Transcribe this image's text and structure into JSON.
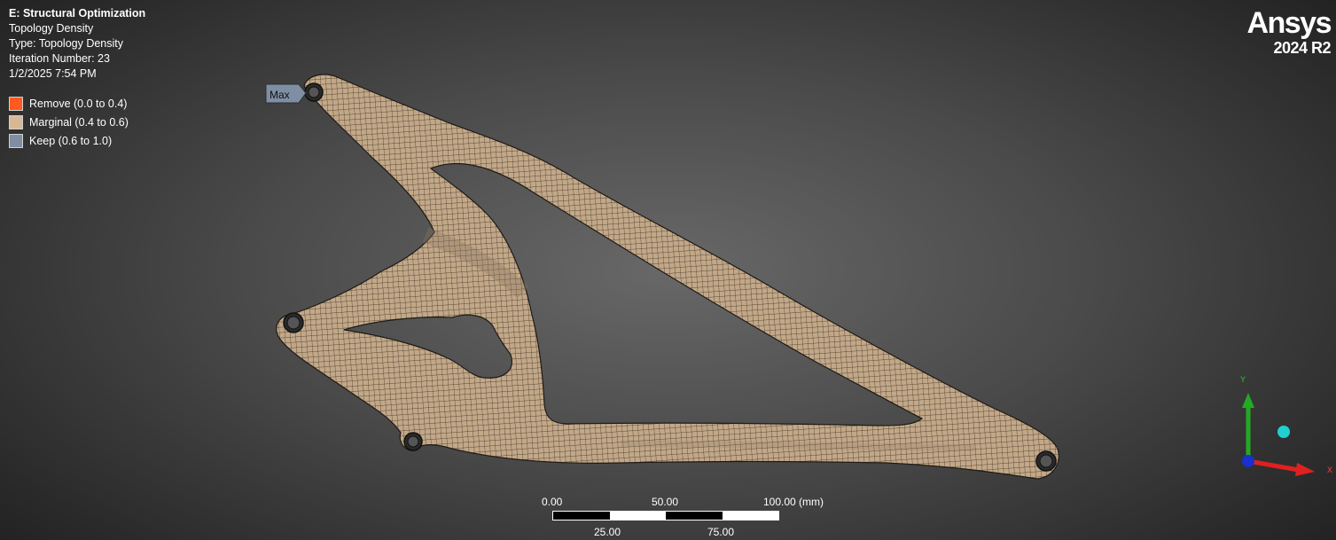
{
  "header": {
    "title": "E: Structural Optimization",
    "lines": [
      "Topology Density",
      "Type: Topology Density",
      "Iteration Number: 23",
      "1/2/2025 7:54 PM"
    ]
  },
  "legend": [
    {
      "label": "Remove (0.0 to 0.4)",
      "color": "#ff5a1f"
    },
    {
      "label": "Marginal (0.4 to 0.6)",
      "color": "#d8b797"
    },
    {
      "label": "Keep (0.6 to 1.0)",
      "color": "#7f8ea3"
    }
  ],
  "brand": {
    "name": "Ansys",
    "version": "2024 R2"
  },
  "probe": {
    "label": "Max"
  },
  "scale_bar": {
    "top_labels": [
      "0.00",
      "50.00",
      "100.00 (mm)"
    ],
    "bottom_labels": [
      "25.00",
      "75.00"
    ]
  },
  "triad": {
    "x_label": "X",
    "y_label": "Y",
    "x_color": "#e02020",
    "y_color": "#22aa22",
    "z_color": "#1a2fd0",
    "iso_color": "#20d0d0"
  },
  "colors": {
    "mesh_fill": "#c2a888",
    "mesh_line": "#3a2e24"
  }
}
